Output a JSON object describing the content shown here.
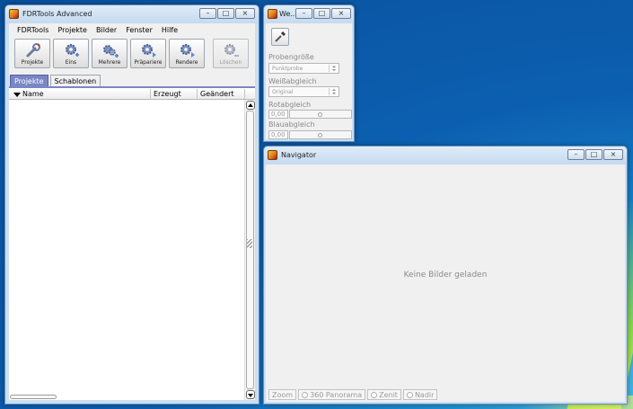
{
  "colors": {
    "accent_tab": "#7b86c4",
    "desktop": "#0c5fb0",
    "titlebar": "#c9dff3"
  },
  "main_window": {
    "title": "FDRTools Advanced",
    "menu": [
      "FDRTools",
      "Projekte",
      "Bilder",
      "Fenster",
      "Hilfe"
    ],
    "toolbar": [
      {
        "label": "Projekte",
        "icon": "wrench-icon",
        "enabled": true
      },
      {
        "label": "Eins",
        "icon": "gear-plus-icon",
        "enabled": true
      },
      {
        "label": "Mehrere",
        "icon": "gears-plus-icon",
        "enabled": true
      },
      {
        "label": "Präpariere",
        "icon": "gear-play-icon",
        "enabled": true
      },
      {
        "label": "Rendere",
        "icon": "gear-play-icon",
        "enabled": true
      },
      {
        "label": "Löschen",
        "icon": "gear-minus-icon",
        "enabled": false
      }
    ],
    "tabs": [
      {
        "label": "Projekte",
        "active": true
      },
      {
        "label": "Schablonen",
        "active": false
      }
    ],
    "columns": [
      "Name",
      "Erzeugt",
      "Geändert"
    ]
  },
  "wb_window": {
    "title": "We...",
    "probe_label": "Probengröße",
    "probe_value": "Punktprobe",
    "wb_label": "Weißabgleich",
    "wb_value": "Original",
    "red_label": "Rotabgleich",
    "red_value": "0,00",
    "blue_label": "Blauabgleich",
    "blue_value": "0,00"
  },
  "navigator": {
    "title": "Navigator",
    "message": "Keine Bilder geladen",
    "buttons": [
      "Zoom",
      "360 Panorama",
      "Zenit",
      "Nadir"
    ]
  }
}
